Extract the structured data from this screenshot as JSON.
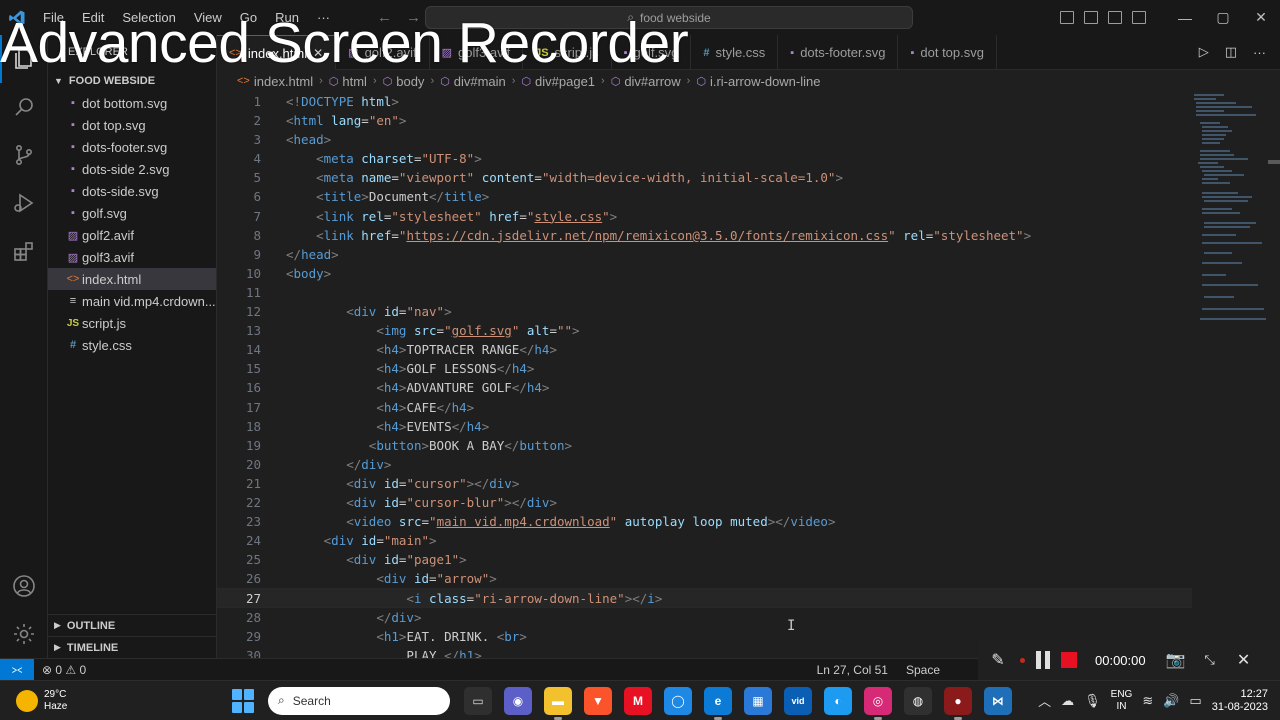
{
  "watermark": "Advanced Screen Recorder",
  "titlebar": {
    "menu": [
      "File",
      "Edit",
      "Selection",
      "View",
      "Go",
      "Run",
      "···"
    ],
    "search_placeholder": "food webside"
  },
  "explorer": {
    "title": "EXPLORER",
    "folder": "FOOD WEBSIDE",
    "files": [
      {
        "name": "dot bottom.svg",
        "type": "svg"
      },
      {
        "name": "dot top.svg",
        "type": "svg"
      },
      {
        "name": "dots-footer.svg",
        "type": "svg"
      },
      {
        "name": "dots-side 2.svg",
        "type": "svg"
      },
      {
        "name": "dots-side.svg",
        "type": "svg"
      },
      {
        "name": "golf.svg",
        "type": "svg"
      },
      {
        "name": "golf2.avif",
        "type": "avif"
      },
      {
        "name": "golf3.avif",
        "type": "avif"
      },
      {
        "name": "index.html",
        "type": "html",
        "selected": true
      },
      {
        "name": "main vid.mp4.crdown...",
        "type": "mp4"
      },
      {
        "name": "script.js",
        "type": "js"
      },
      {
        "name": "style.css",
        "type": "css"
      }
    ],
    "outline": "OUTLINE",
    "timeline": "TIMELINE"
  },
  "tabs": [
    {
      "label": "index.html",
      "type": "html",
      "active": true
    },
    {
      "label": "golf2.avif",
      "type": "avif"
    },
    {
      "label": "golf3.avif",
      "type": "avif"
    },
    {
      "label": "script.js",
      "type": "js"
    },
    {
      "label": "golf.svg",
      "type": "svg"
    },
    {
      "label": "style.css",
      "type": "css"
    },
    {
      "label": "dots-footer.svg",
      "type": "svg"
    },
    {
      "label": "dot top.svg",
      "type": "svg"
    }
  ],
  "breadcrumb": [
    "index.html",
    "html",
    "body",
    "div#main",
    "div#page1",
    "div#arrow",
    "i.ri-arrow-down-line"
  ],
  "code_lines": [
    {
      "n": "1",
      "indent": 0,
      "html": "<span class='t'>&lt;!</span><span class='tg'>DOCTYPE</span> <span class='at'>html</span><span class='t'>&gt;</span>"
    },
    {
      "n": "2",
      "indent": 0,
      "html": "<span class='t'>&lt;</span><span class='tg'>html</span> <span class='at'>lang</span><span class='tx'>=</span><span class='st'>\"en\"</span><span class='t'>&gt;</span>"
    },
    {
      "n": "3",
      "indent": 0,
      "html": "<span class='t'>&lt;</span><span class='tg'>head</span><span class='t'>&gt;</span>"
    },
    {
      "n": "4",
      "indent": 4,
      "html": "<span class='t'>&lt;</span><span class='tg'>meta</span> <span class='at'>charset</span><span class='tx'>=</span><span class='st'>\"UTF-8\"</span><span class='t'>&gt;</span>"
    },
    {
      "n": "5",
      "indent": 4,
      "html": "<span class='t'>&lt;</span><span class='tg'>meta</span> <span class='at'>name</span><span class='tx'>=</span><span class='st'>\"viewport\"</span> <span class='at'>content</span><span class='tx'>=</span><span class='st'>\"width=device-width, initial-scale=1.0\"</span><span class='t'>&gt;</span>"
    },
    {
      "n": "6",
      "indent": 4,
      "html": "<span class='t'>&lt;</span><span class='tg'>title</span><span class='t'>&gt;</span><span class='tx'>Document</span><span class='t'>&lt;/</span><span class='tg'>title</span><span class='t'>&gt;</span>"
    },
    {
      "n": "7",
      "indent": 4,
      "html": "<span class='t'>&lt;</span><span class='tg'>link</span> <span class='at'>rel</span><span class='tx'>=</span><span class='st'>\"stylesheet\"</span> <span class='at'>href</span><span class='tx'>=</span><span class='st'>\"<span class='ul'>style.css</span>\"</span><span class='t'>&gt;</span>"
    },
    {
      "n": "8",
      "indent": 4,
      "html": "<span class='t'>&lt;</span><span class='tg'>link</span> <span class='at'>href</span><span class='tx'>=</span><span class='st'>\"<span class='ul'>https://cdn.jsdelivr.net/npm/remixicon@3.5.0/fonts/remixicon.css</span>\"</span> <span class='at'>rel</span><span class='tx'>=</span><span class='st'>\"stylesheet\"</span><span class='t'>&gt;</span>"
    },
    {
      "n": "9",
      "indent": 0,
      "html": "<span class='t'>&lt;/</span><span class='tg'>head</span><span class='t'>&gt;</span>"
    },
    {
      "n": "10",
      "indent": 0,
      "html": "<span class='t'>&lt;</span><span class='tg'>body</span><span class='t'>&gt;</span>"
    },
    {
      "n": "11",
      "indent": 0,
      "html": ""
    },
    {
      "n": "12",
      "indent": 8,
      "html": "<span class='t'>&lt;</span><span class='tg'>div</span> <span class='at'>id</span><span class='tx'>=</span><span class='st'>\"nav\"</span><span class='t'>&gt;</span>"
    },
    {
      "n": "13",
      "indent": 12,
      "html": "<span class='t'>&lt;</span><span class='tg'>img</span> <span class='at'>src</span><span class='tx'>=</span><span class='st'>\"<span class='ul'>golf.svg</span>\"</span> <span class='at'>alt</span><span class='tx'>=</span><span class='st'>\"\"</span><span class='t'>&gt;</span>"
    },
    {
      "n": "14",
      "indent": 12,
      "html": "<span class='t'>&lt;</span><span class='tg'>h4</span><span class='t'>&gt;</span><span class='tx'>TOPTRACER RANGE</span><span class='t'>&lt;/</span><span class='tg'>h4</span><span class='t'>&gt;</span>"
    },
    {
      "n": "15",
      "indent": 12,
      "html": "<span class='t'>&lt;</span><span class='tg'>h4</span><span class='t'>&gt;</span><span class='tx'>GOLF LESSONS</span><span class='t'>&lt;/</span><span class='tg'>h4</span><span class='t'>&gt;</span>"
    },
    {
      "n": "16",
      "indent": 12,
      "html": "<span class='t'>&lt;</span><span class='tg'>h4</span><span class='t'>&gt;</span><span class='tx'>ADVANTURE GOLF</span><span class='t'>&lt;/</span><span class='tg'>h4</span><span class='t'>&gt;</span>"
    },
    {
      "n": "17",
      "indent": 12,
      "html": "<span class='t'>&lt;</span><span class='tg'>h4</span><span class='t'>&gt;</span><span class='tx'>CAFE</span><span class='t'>&lt;/</span><span class='tg'>h4</span><span class='t'>&gt;</span>"
    },
    {
      "n": "18",
      "indent": 12,
      "html": "<span class='t'>&lt;</span><span class='tg'>h4</span><span class='t'>&gt;</span><span class='tx'>EVENTS</span><span class='t'>&lt;/</span><span class='tg'>h4</span><span class='t'>&gt;</span>"
    },
    {
      "n": "19",
      "indent": 11,
      "html": "<span class='t'>&lt;</span><span class='tg'>button</span><span class='t'>&gt;</span><span class='tx'>BOOK A BAY</span><span class='t'>&lt;/</span><span class='tg'>button</span><span class='t'>&gt;</span>"
    },
    {
      "n": "20",
      "indent": 8,
      "html": "<span class='t'>&lt;/</span><span class='tg'>div</span><span class='t'>&gt;</span>"
    },
    {
      "n": "21",
      "indent": 8,
      "html": "<span class='t'>&lt;</span><span class='tg'>div</span> <span class='at'>id</span><span class='tx'>=</span><span class='st'>\"cursor\"</span><span class='t'>&gt;&lt;/</span><span class='tg'>div</span><span class='t'>&gt;</span>"
    },
    {
      "n": "22",
      "indent": 8,
      "html": "<span class='t'>&lt;</span><span class='tg'>div</span> <span class='at'>id</span><span class='tx'>=</span><span class='st'>\"cursor-blur\"</span><span class='t'>&gt;&lt;/</span><span class='tg'>div</span><span class='t'>&gt;</span>"
    },
    {
      "n": "23",
      "indent": 8,
      "html": "<span class='t'>&lt;</span><span class='tg'>video</span> <span class='at'>src</span><span class='tx'>=</span><span class='st'>\"<span class='ul'>main vid.mp4.crdownload</span>\"</span> <span class='at'>autoplay</span> <span class='at'>loop</span> <span class='at'>muted</span><span class='t'>&gt;&lt;/</span><span class='tg'>video</span><span class='t'>&gt;</span>"
    },
    {
      "n": "24",
      "indent": 5,
      "html": "<span class='t'>&lt;</span><span class='tg'>div</span> <span class='at'>id</span><span class='tx'>=</span><span class='st'>\"main\"</span><span class='t'>&gt;</span>"
    },
    {
      "n": "25",
      "indent": 8,
      "html": "<span class='t'>&lt;</span><span class='tg'>div</span> <span class='at'>id</span><span class='tx'>=</span><span class='st'>\"page1\"</span><span class='t'>&gt;</span>"
    },
    {
      "n": "26",
      "indent": 12,
      "html": "<span class='t'>&lt;</span><span class='tg'>div</span> <span class='at'>id</span><span class='tx'>=</span><span class='st'>\"arrow\"</span><span class='t'>&gt;</span>"
    },
    {
      "n": "27",
      "indent": 16,
      "current": true,
      "html": "<span class='t'>&lt;</span><span class='tg'>i</span> <span class='at'>class</span><span class='tx'>=</span><span class='st'>\"ri-arrow-down-line\"</span><span class='t'>&gt;&lt;/</span><span class='tg'>i</span><span class='t'>&gt;</span>"
    },
    {
      "n": "28",
      "indent": 12,
      "html": "<span class='t'>&lt;/</span><span class='tg'>div</span><span class='t'>&gt;</span>"
    },
    {
      "n": "29",
      "indent": 12,
      "html": "<span class='t'>&lt;</span><span class='tg'>h1</span><span class='t'>&gt;</span><span class='tx'>EAT. DRINK. </span><span class='t'>&lt;</span><span class='tg'>br</span><span class='t'>&gt;</span>"
    },
    {
      "n": "30",
      "indent": 16,
      "html": "<span class='tx'>PLAY.</span><span class='t'>&lt;/</span><span class='tg'>h1</span><span class='t'>&gt;</span>"
    }
  ],
  "statusbar": {
    "problems": "⊗ 0 ⚠ 0",
    "cursor_pos": "Ln 27, Col 51",
    "spaces": "Space"
  },
  "recorder": {
    "time": "00:00:00"
  },
  "taskbar": {
    "weather_temp": "29°C",
    "weather_desc": "Haze",
    "search_label": "Search",
    "lang_line1": "ENG",
    "lang_line2": "IN",
    "time": "12:27",
    "date": "31-08-2023"
  },
  "colors": {
    "accent": "#0078d4",
    "svg_icon": "#b180d7",
    "html_icon": "#e37933",
    "js_icon": "#cbcb41",
    "css_icon": "#519aba",
    "tag": "#569cd6",
    "attr": "#9cdcfe",
    "string": "#ce9178"
  }
}
